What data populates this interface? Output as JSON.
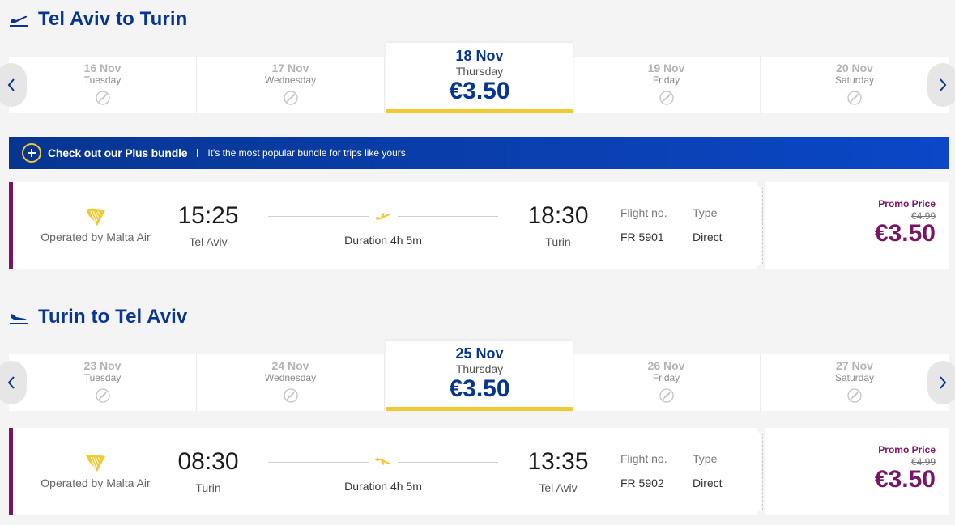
{
  "colors": {
    "brand_blue": "#073590",
    "accent_yellow": "#f1c933",
    "promo_purple": "#7a1466"
  },
  "outbound": {
    "title": "Tel Aviv to Turin",
    "dates": [
      {
        "date": "16 Nov",
        "weekday": "Tuesday",
        "status_icon": "no-flights-icon"
      },
      {
        "date": "17 Nov",
        "weekday": "Wednesday",
        "status_icon": "no-flights-icon"
      },
      {
        "date": "18 Nov",
        "weekday": "Thursday",
        "price": "€3.50",
        "selected": true
      },
      {
        "date": "19 Nov",
        "weekday": "Friday",
        "status_icon": "no-flights-icon"
      },
      {
        "date": "20 Nov",
        "weekday": "Saturday",
        "status_icon": "no-flights-icon"
      }
    ],
    "flight": {
      "operator": "Operated by Malta Air",
      "depart_time": "15:25",
      "depart_city": "Tel Aviv",
      "duration": "Duration 4h 5m",
      "arrive_time": "18:30",
      "arrive_city": "Turin",
      "flight_no_label": "Flight no.",
      "flight_no": "FR 5901",
      "type_label": "Type",
      "type": "Direct",
      "promo_label": "Promo Price",
      "old_price": "€4.99",
      "price": "€3.50"
    }
  },
  "banner": {
    "title": "Check out our Plus bundle",
    "description": "It's the most popular bundle for trips like yours."
  },
  "inbound": {
    "title": "Turin to Tel Aviv",
    "dates": [
      {
        "date": "23 Nov",
        "weekday": "Tuesday",
        "status_icon": "no-flights-icon"
      },
      {
        "date": "24 Nov",
        "weekday": "Wednesday",
        "status_icon": "no-flights-icon"
      },
      {
        "date": "25 Nov",
        "weekday": "Thursday",
        "price": "€3.50",
        "selected": true
      },
      {
        "date": "26 Nov",
        "weekday": "Friday",
        "status_icon": "no-flights-icon"
      },
      {
        "date": "27 Nov",
        "weekday": "Saturday",
        "status_icon": "no-flights-icon"
      }
    ],
    "flight": {
      "operator": "Operated by Malta Air",
      "depart_time": "08:30",
      "depart_city": "Turin",
      "duration": "Duration 4h 5m",
      "arrive_time": "13:35",
      "arrive_city": "Tel Aviv",
      "flight_no_label": "Flight no.",
      "flight_no": "FR 5902",
      "type_label": "Type",
      "type": "Direct",
      "promo_label": "Promo Price",
      "old_price": "€4.99",
      "price": "€3.50"
    }
  }
}
